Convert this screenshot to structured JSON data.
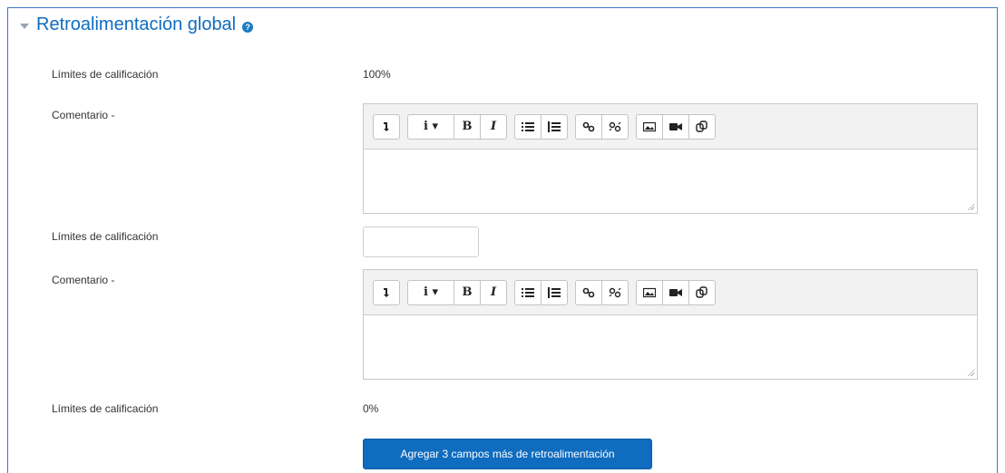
{
  "section": {
    "title": "Retroalimentación global",
    "help_icon": "?"
  },
  "rows": [
    {
      "label": "Límites de calificación",
      "value": "100%"
    },
    {
      "label": "Comentario -"
    },
    {
      "label": "Límites de calificación",
      "value": ""
    },
    {
      "label": "Comentario -"
    },
    {
      "label": "Límites de calificación",
      "value": "0%"
    }
  ],
  "toolbar": {
    "info_label": "i ▾",
    "bold_label": "B",
    "italic_label": "I"
  },
  "editor1": {
    "content": ""
  },
  "editor2": {
    "content": ""
  },
  "add_button": {
    "label": "Agregar 3 campos más de retroalimentación"
  },
  "colors": {
    "accent": "#0f6cbf",
    "frame": "#3b78c4"
  }
}
